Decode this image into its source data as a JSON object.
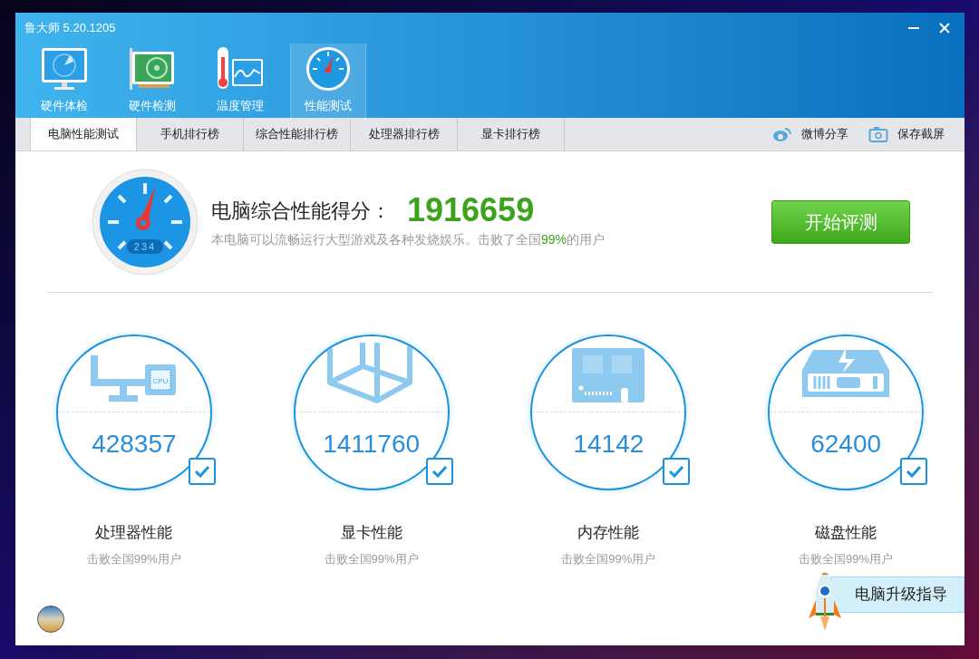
{
  "window": {
    "title": "鲁大师 5.20.1205"
  },
  "nav": [
    {
      "label": "硬件体检",
      "kind": "monitor",
      "selected": false
    },
    {
      "label": "硬件检测",
      "kind": "card",
      "selected": false
    },
    {
      "label": "温度管理",
      "kind": "thermo",
      "selected": false
    },
    {
      "label": "性能测试",
      "kind": "gauge",
      "selected": true
    }
  ],
  "tabs": [
    {
      "label": "电脑性能测试",
      "selected": true
    },
    {
      "label": "手机排行榜",
      "selected": false
    },
    {
      "label": "综合性能排行榜",
      "selected": false
    },
    {
      "label": "处理器排行榜",
      "selected": false
    },
    {
      "label": "显卡排行榜",
      "selected": false
    }
  ],
  "actions": [
    {
      "label": "微博分享",
      "kind": "weibo"
    },
    {
      "label": "保存截屏",
      "kind": "camera"
    }
  ],
  "score": {
    "gauge_display": "234",
    "title": "电脑综合性能得分：",
    "value": "1916659",
    "description": {
      "before": "本电脑可以流畅运行大型游戏及各种发烧娱乐。击败了全国",
      "highlight": "99%",
      "after": "的用户"
    },
    "button": "开始评测"
  },
  "metrics": [
    {
      "kind": "cpu",
      "icon_text": "CPU",
      "value": "428357",
      "label": "处理器性能",
      "note": "击败全国99%用户",
      "checked": true
    },
    {
      "kind": "gpu",
      "value": "1411760",
      "label": "显卡性能",
      "note": "击败全国99%用户",
      "checked": true
    },
    {
      "kind": "memory",
      "value": "14142",
      "label": "内存性能",
      "note": "击败全国99%用户",
      "checked": true
    },
    {
      "kind": "disk",
      "value": "62400",
      "label": "磁盘性能",
      "note": "击败全国99%用户",
      "checked": true
    }
  ],
  "upgrade_guide": "电脑升级指导"
}
